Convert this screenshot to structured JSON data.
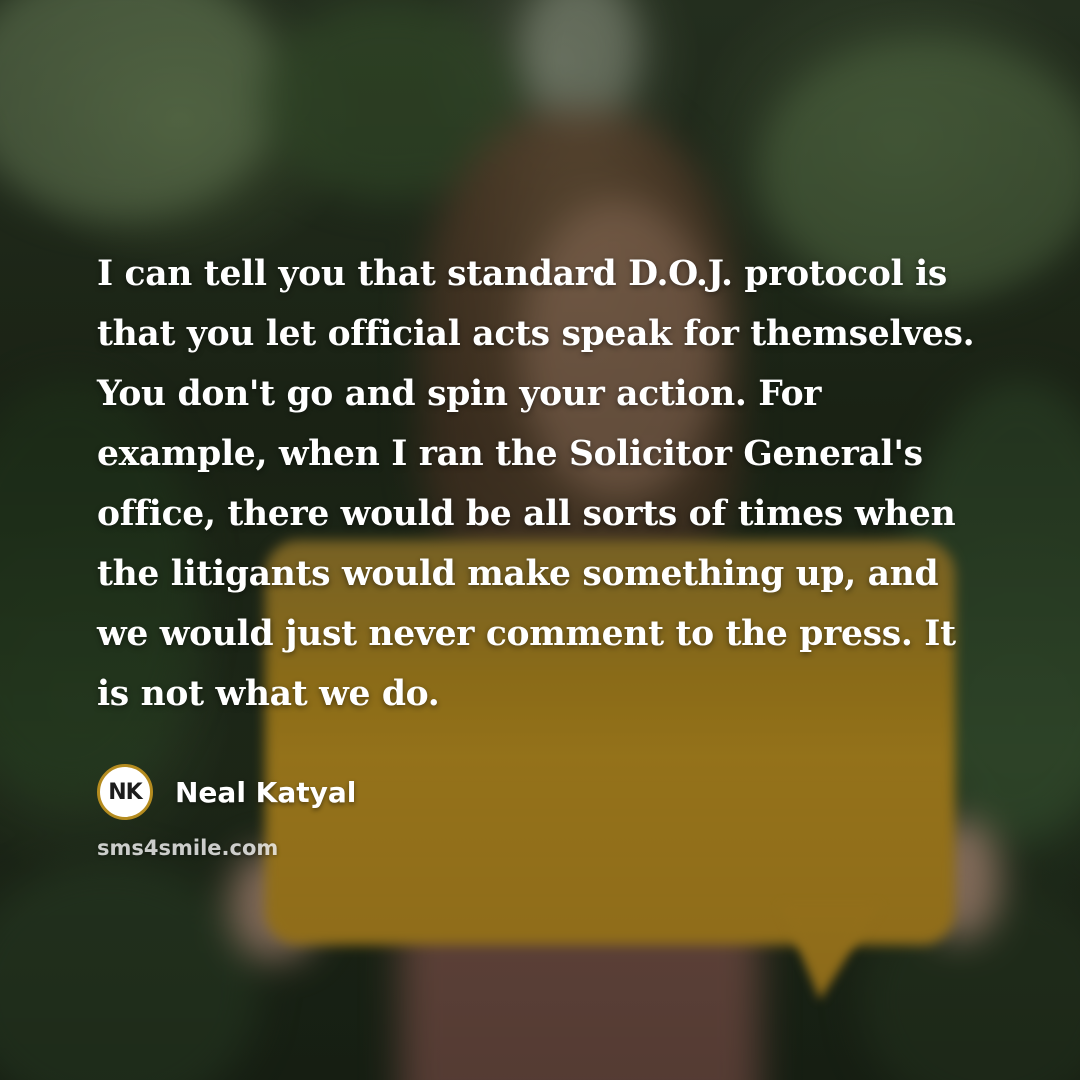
{
  "quote": {
    "lines": [
      "I can tell you that standard D.O.J. protocol is",
      "that you let official acts speak for themselves.",
      "You don't go and spin your action. For",
      "example, when I ran the Solicitor General's",
      "office, there would be all sorts of times when",
      "the litigants would make something up, and",
      "we would just never comment to the press. It",
      "is not what we do."
    ]
  },
  "author": {
    "initials": "NK",
    "name": "Neal Katyal"
  },
  "website": "sms4smile.com",
  "colors": {
    "accent": "#b58c1f",
    "text": "#ffffff"
  }
}
